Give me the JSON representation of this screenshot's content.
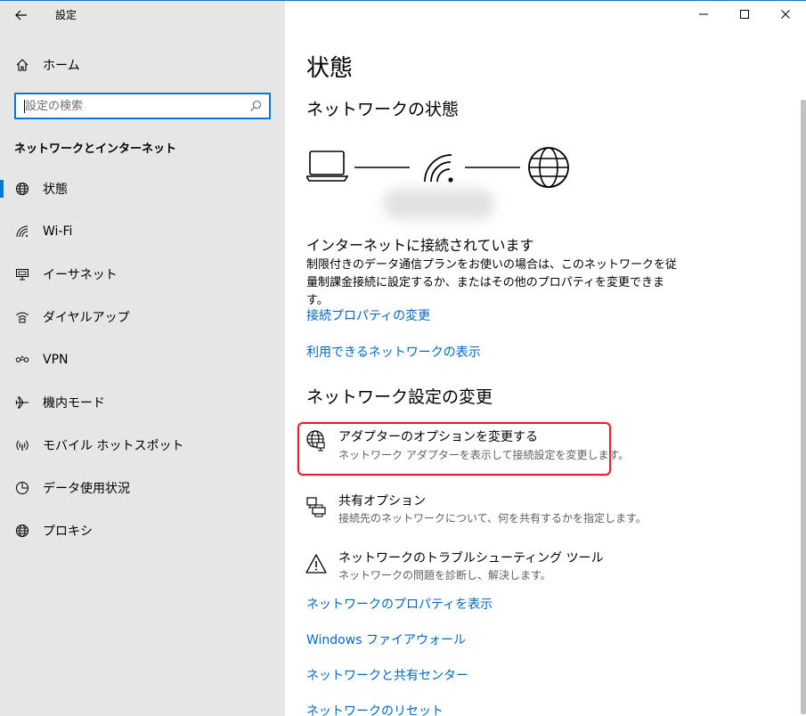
{
  "window": {
    "title": "設定",
    "controls": [
      "minimize-icon",
      "maximize-icon",
      "close-icon"
    ]
  },
  "sidebar": {
    "home_label": "ホーム",
    "search": {
      "placeholder": "設定の検索",
      "value": ""
    },
    "section_title": "ネットワークとインターネット",
    "items": [
      {
        "label": "状態",
        "icon": "globe-icon",
        "active": true
      },
      {
        "label": "Wi-Fi",
        "icon": "wifi-icon",
        "active": false
      },
      {
        "label": "イーサネット",
        "icon": "ethernet-icon",
        "active": false
      },
      {
        "label": "ダイヤルアップ",
        "icon": "dialup-icon",
        "active": false
      },
      {
        "label": "VPN",
        "icon": "vpn-icon",
        "active": false
      },
      {
        "label": "機内モード",
        "icon": "airplane-icon",
        "active": false
      },
      {
        "label": "モバイル ホットスポット",
        "icon": "hotspot-icon",
        "active": false
      },
      {
        "label": "データ使用状況",
        "icon": "data-usage-icon",
        "active": false
      },
      {
        "label": "プロキシ",
        "icon": "globe-icon",
        "active": false
      }
    ]
  },
  "main": {
    "title": "状態",
    "network_status_heading": "ネットワークの状態",
    "connection_title": "インターネットに接続されています",
    "description": "制限付きのデータ通信プランをお使いの場合は、このネットワークを従量制課金接続に設定するか、またはその他のプロパティを変更できます。",
    "links_top": [
      "接続プロパティの変更",
      "利用できるネットワークの表示"
    ],
    "change_settings_heading": "ネットワーク設定の変更",
    "options": [
      {
        "title": "アダプターのオプションを変更する",
        "desc": "ネットワーク アダプターを表示して接続設定を変更します。",
        "icon": "adapter-globe-icon",
        "highlighted": true
      },
      {
        "title": "共有オプション",
        "desc": "接続先のネットワークについて、何を共有するかを指定します。",
        "icon": "sharing-printer-icon",
        "highlighted": false
      },
      {
        "title": "ネットワークのトラブルシューティング ツール",
        "desc": "ネットワークの問題を診断し、解決します。",
        "icon": "warning-icon",
        "highlighted": false
      }
    ],
    "links_bottom": [
      "ネットワークのプロパティを表示",
      "Windows ファイアウォール",
      "ネットワークと共有センター",
      "ネットワークのリセット"
    ]
  },
  "colors": {
    "accent": "#0078d7",
    "link": "#0067c0",
    "highlight_border": "#e0202e",
    "sidebar_bg": "#e6e6e6"
  }
}
